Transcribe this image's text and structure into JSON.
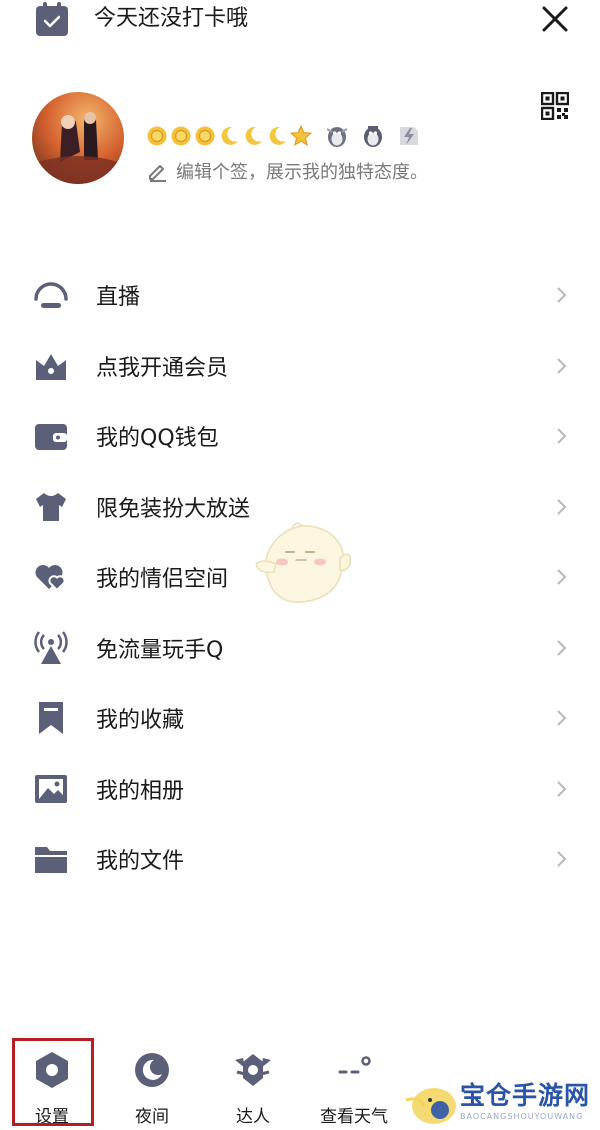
{
  "topbar": {
    "checkin_text": "今天还没打卡哦",
    "checkin_icon": "calendar-check-icon",
    "close_icon": "close-icon"
  },
  "profile": {
    "avatar": "avatar",
    "qr_icon": "qr-code-icon",
    "level_icons": [
      "sun",
      "sun",
      "sun",
      "moon",
      "moon",
      "moon",
      "star",
      "penguin-badge",
      "penguin-badge",
      "vip-lightning-badge"
    ],
    "signature_icon": "pencil-icon",
    "signature": "编辑个签，展示我的独特态度。"
  },
  "menu": {
    "items": [
      {
        "label": "直播",
        "icon": "live-icon"
      },
      {
        "label": "点我开通会员",
        "icon": "vip-crown-icon"
      },
      {
        "label": "我的QQ钱包",
        "icon": "wallet-icon"
      },
      {
        "label": "限免装扮大放送",
        "icon": "tshirt-icon"
      },
      {
        "label": "我的情侣空间",
        "icon": "couple-hearts-icon"
      },
      {
        "label": "免流量玩手Q",
        "icon": "signal-tower-icon"
      },
      {
        "label": "我的收藏",
        "icon": "bookmark-icon"
      },
      {
        "label": "我的相册",
        "icon": "photo-album-icon"
      },
      {
        "label": "我的文件",
        "icon": "folder-icon"
      }
    ]
  },
  "bottombar": {
    "items": [
      {
        "label": "设置",
        "icon": "settings-hexagon-icon"
      },
      {
        "label": "夜间",
        "icon": "night-moon-icon"
      },
      {
        "label": "达人",
        "icon": "expert-badge-icon"
      },
      {
        "label": "查看天气",
        "icon": "weather-icon"
      }
    ]
  },
  "watermark": {
    "text": "宝仓手游网",
    "sub": "BAOCANGSHOUYOUWANG"
  },
  "colors": {
    "icon_gray": "#5c5f78",
    "highlight": "#b51f24",
    "chevron": "#b8b8b8"
  }
}
